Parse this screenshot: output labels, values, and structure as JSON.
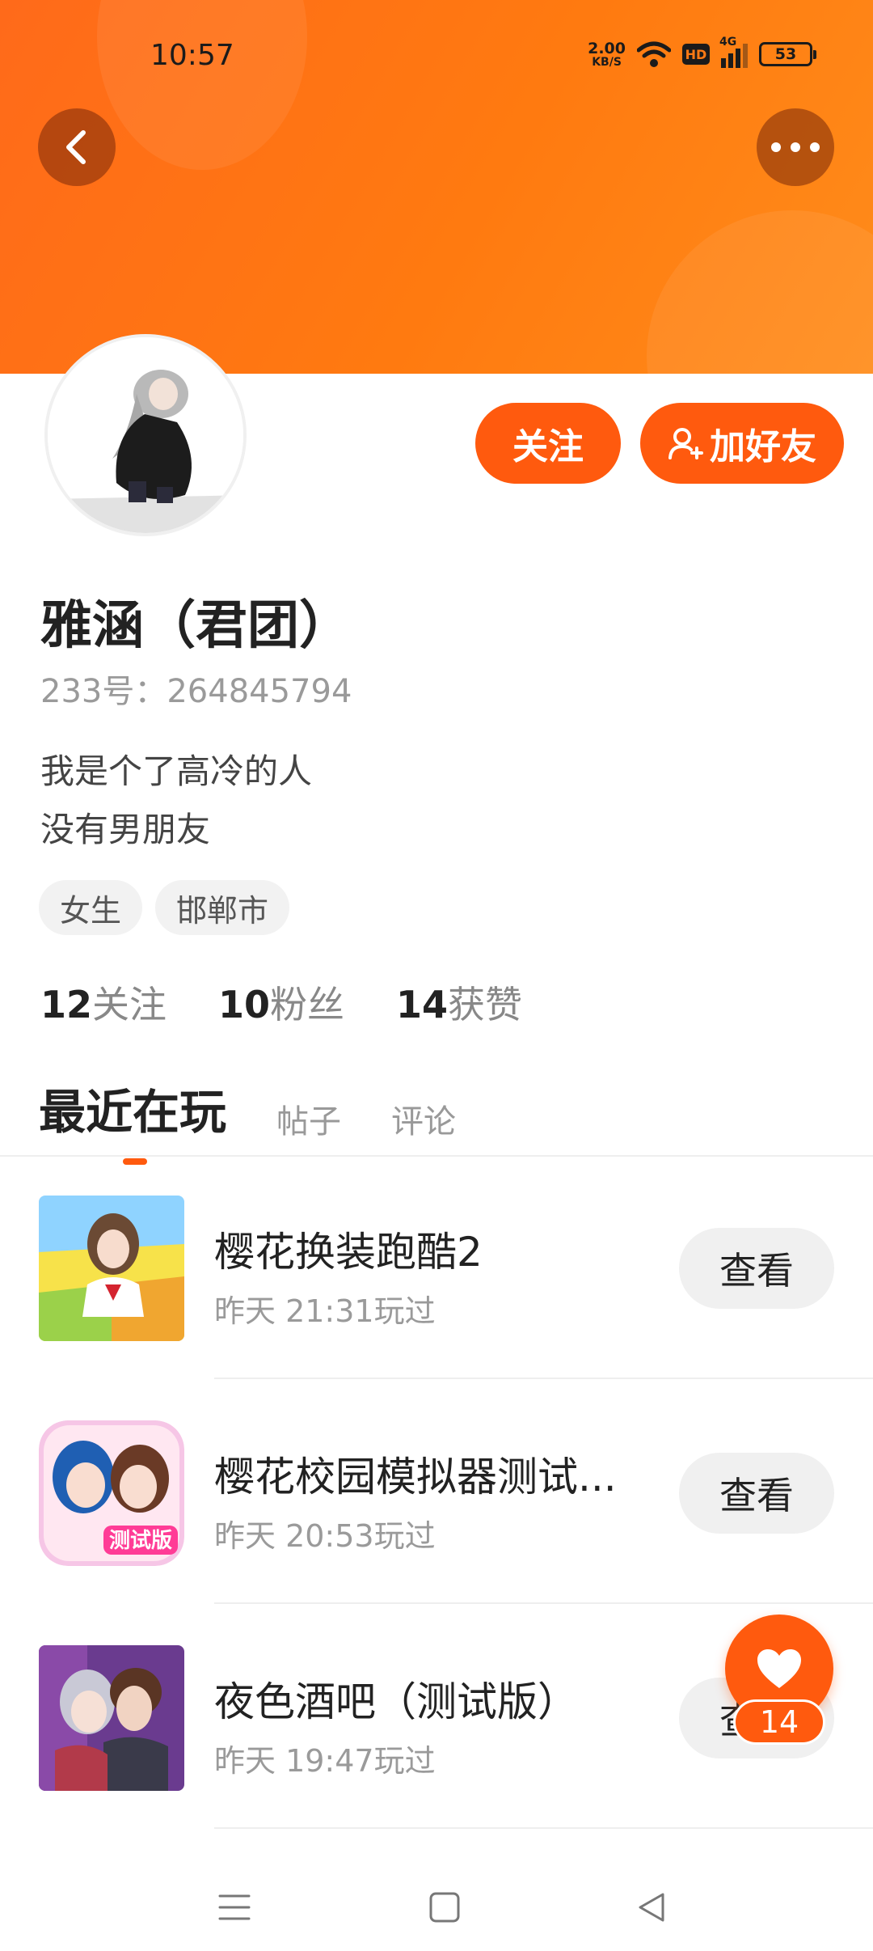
{
  "status_bar": {
    "time": "10:57",
    "net_speed_top": "2.00",
    "net_speed_bottom": "KB/S",
    "hd": "HD",
    "signal_label": "4G",
    "battery": "53"
  },
  "header": {
    "back_icon": "chevron-left-icon",
    "more_icon": "more-dots-icon"
  },
  "profile": {
    "follow_label": "关注",
    "add_friend_label": "加好友",
    "name": "雅涵（君团）",
    "uid": "233号：264845794",
    "bio_line1": "我是个了高冷的人",
    "bio_line2": "没有男朋友",
    "tags": [
      "女生",
      "邯郸市"
    ],
    "stats": [
      {
        "num": "12",
        "label": "关注"
      },
      {
        "num": "10",
        "label": "粉丝"
      },
      {
        "num": "14",
        "label": "获赞"
      }
    ]
  },
  "tabs": [
    "最近在玩",
    "帖子",
    "评论"
  ],
  "games": [
    {
      "title": "樱花换装跑酷2",
      "time": "昨天 21:31玩过",
      "button": "查看"
    },
    {
      "title": "樱花校园模拟器测试...",
      "time": "昨天 20:53玩过",
      "button": "查看"
    },
    {
      "title": "夜色酒吧（测试版）",
      "time": "昨天 19:47玩过",
      "button": "查看"
    }
  ],
  "like": {
    "count": "14"
  },
  "colors": {
    "accent": "#ff5a0e",
    "banner": "#ff7a10"
  }
}
